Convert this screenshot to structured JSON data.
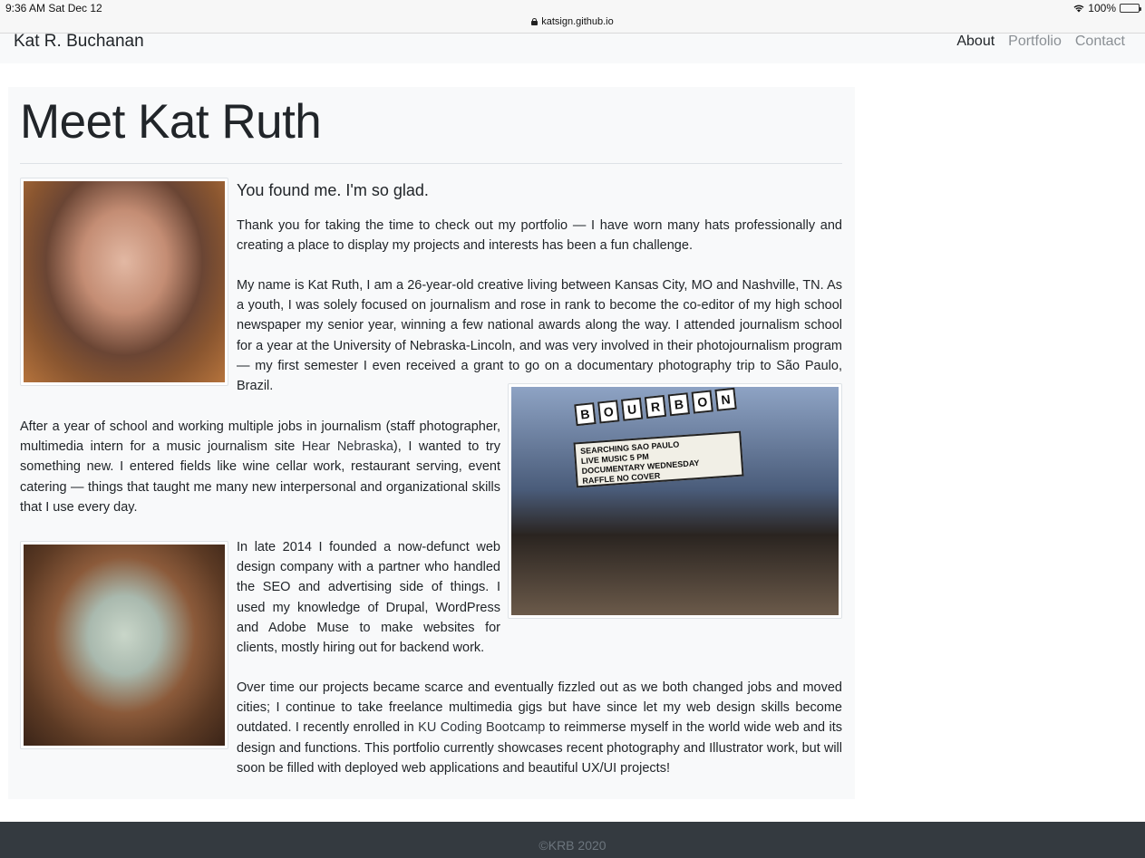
{
  "status_bar": {
    "time": "9:36 AM   Sat Dec 12",
    "battery": "100%",
    "url": "katsign.github.io"
  },
  "nav": {
    "brand": "Kat R. Buchanan",
    "links": [
      "About",
      "Portfolio",
      "Contact"
    ],
    "active": "About"
  },
  "main": {
    "title": "Meet Kat Ruth",
    "lead": "You found me. I'm so glad.",
    "p1": "Thank you for taking the time to check out my portfolio — I have worn many hats professionally and creating a place to display my projects and interests has been a fun challenge.",
    "p2": "My name is Kat Ruth, I am a 26-year-old creative living between Kansas City, MO and Nashville, TN. As a youth, I was solely focused on journalism and rose in rank to become the co-editor of my high school newspaper my senior year, winning a few national awards along the way. I attended journalism school for a year at the University of Nebraska-Lincoln, and was very involved in their photojournalism program — my first semester I even received a grant to go on a documentary photography trip to São Paulo, Brazil.",
    "p3_before": "After a year of school and working multiple jobs in journalism (staff photographer, multimedia intern for a music journalism site ",
    "p3_link": "Hear Nebraska",
    "p3_after": "), I wanted to try something new. I entered fields like wine cellar work, restaurant serving, event catering — things that taught me many new interpersonal and organizational skills that I use every day.",
    "p4": "In late 2014 I founded a now-defunct web design company with a partner who handled the SEO and advertising side of things. I used my knowledge of Drupal, WordPress and Adobe Muse to make websites for clients, mostly hiring out for backend work.",
    "p5_before": "Over time our projects became scarce and eventually fizzled out as we both changed jobs and moved cities; I continue to take freelance multimedia gigs but have since let my web design skills become outdated. I recently enrolled in ",
    "p5_link": "KU Coding Bootcamp",
    "p5_after": " to reimmerse myself in the world wide web and its design and functions. This portfolio currently showcases recent photography and Illustrator work, but will soon be filled with deployed web applications and beautiful UX/UI projects!"
  },
  "marquee": {
    "letters": [
      "B",
      "O",
      "U",
      "R",
      "B",
      "O",
      "N"
    ],
    "line1": "SEARCHING  SAO PAULO",
    "line2": "LIVE MUSIC         5 PM",
    "line3": "DOCUMENTARY  WEDNESDAY",
    "line4": "RAFFLE          NO COVER"
  },
  "footer": {
    "text": "©KRB 2020"
  }
}
